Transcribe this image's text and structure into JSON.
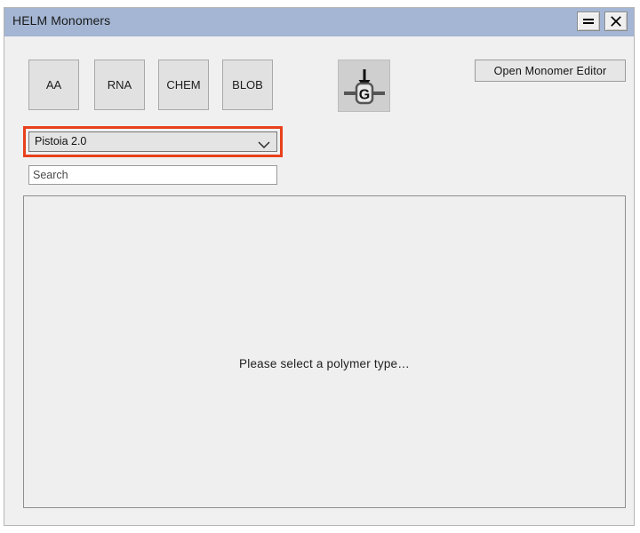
{
  "window": {
    "title": "HELM Monomers",
    "title_bar_color": "#a4b6d4",
    "background_color": "#f0f0f0",
    "controls": [
      {
        "name": "minimize",
        "glyph": "double-bar"
      },
      {
        "name": "close",
        "glyph": "x-mark"
      }
    ]
  },
  "toolbar": {
    "polymer_buttons": [
      {
        "id": "aa",
        "label": "AA"
      },
      {
        "id": "rna",
        "label": "RNA"
      },
      {
        "id": "chem",
        "label": "CHEM"
      },
      {
        "id": "blob",
        "label": "BLOB"
      }
    ],
    "glyph_button": {
      "icon": "monomer-g-icon",
      "monomer_letter": "G",
      "tooltip": ""
    },
    "open_editor_button": {
      "label": "Open Monomer Editor"
    }
  },
  "library": {
    "selected": "Pistoia 2.0",
    "chevron_icon": "chevron-down-icon",
    "highlight_color": "#e8411c",
    "highlighted": true
  },
  "search": {
    "value": "",
    "placeholder": "Search"
  },
  "content": {
    "empty_message": "Please select a polymer type…"
  }
}
